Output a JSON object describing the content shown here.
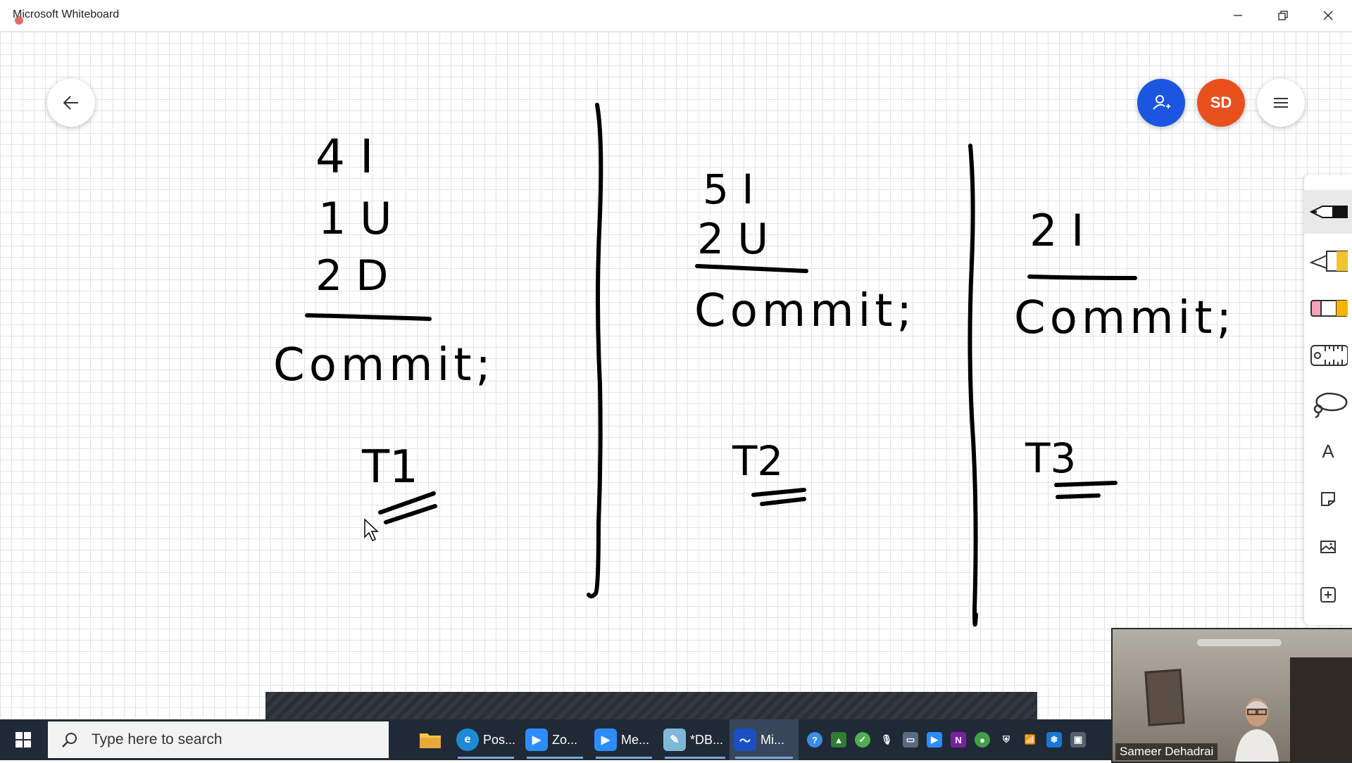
{
  "window": {
    "title": "Microsoft Whiteboard"
  },
  "header": {
    "avatar_initials": "SD"
  },
  "board": {
    "col1": {
      "line1": "4 I",
      "line2": "1 U",
      "line3": "2 D",
      "commit": "Commit;",
      "label": "T1"
    },
    "col2": {
      "line1": "5 I",
      "line2": "2 U",
      "commit": "Commit;",
      "label": "T2"
    },
    "col3": {
      "line1": "2 I",
      "commit": "Commit;",
      "label": "T3"
    }
  },
  "toolbar": {
    "text_tool": "A"
  },
  "taskbar": {
    "search_placeholder": "Type here to search",
    "items": [
      {
        "label": "Pos...",
        "icon": "edge-icon"
      },
      {
        "label": "Zo...",
        "icon": "zoom-icon"
      },
      {
        "label": "Me...",
        "icon": "zoom-meeting-icon"
      },
      {
        "label": "*DB...",
        "icon": "notepad-icon"
      },
      {
        "label": "Mi...",
        "icon": "whiteboard-icon"
      }
    ]
  },
  "video": {
    "participant_name": "Sameer Dehadrai"
  },
  "colors": {
    "invite": "#1a56e0",
    "avatar": "#e8501e",
    "taskbar": "#1f2a36"
  }
}
